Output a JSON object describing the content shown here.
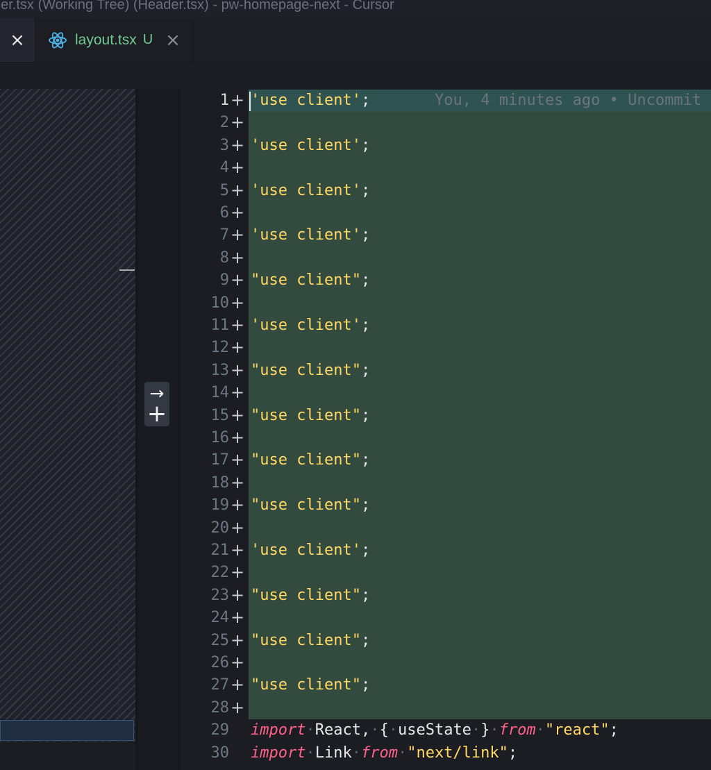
{
  "window": {
    "title": "der.tsx (Working Tree) (Header.tsx) - pw-homepage-next - Cursor"
  },
  "tabs": {
    "previous_close": "×",
    "active": {
      "name": "layout.tsx",
      "status": "U",
      "close": "×",
      "icon": "react-icon"
    }
  },
  "diff": {
    "revert_arrow": "→",
    "revert_plus": "+",
    "blame": "You, 4 minutes ago • Uncommit",
    "inserted_marker": "+"
  },
  "editor": {
    "lines": [
      {
        "n": "1",
        "text": "'use client';",
        "added": true
      },
      {
        "n": "2",
        "text": "",
        "added": true
      },
      {
        "n": "3",
        "text": "'use client';",
        "added": true
      },
      {
        "n": "4",
        "text": "",
        "added": true
      },
      {
        "n": "5",
        "text": "'use client';",
        "added": true
      },
      {
        "n": "6",
        "text": "",
        "added": true
      },
      {
        "n": "7",
        "text": "'use client';",
        "added": true
      },
      {
        "n": "8",
        "text": "",
        "added": true
      },
      {
        "n": "9",
        "text": "\"use client\";",
        "added": true
      },
      {
        "n": "10",
        "text": "",
        "added": true
      },
      {
        "n": "11",
        "text": "'use client';",
        "added": true
      },
      {
        "n": "12",
        "text": "",
        "added": true
      },
      {
        "n": "13",
        "text": "\"use client\";",
        "added": true
      },
      {
        "n": "14",
        "text": "",
        "added": true
      },
      {
        "n": "15",
        "text": "\"use client\";",
        "added": true
      },
      {
        "n": "16",
        "text": "",
        "added": true
      },
      {
        "n": "17",
        "text": "\"use client\";",
        "added": true
      },
      {
        "n": "18",
        "text": "",
        "added": true
      },
      {
        "n": "19",
        "text": "\"use client\";",
        "added": true
      },
      {
        "n": "20",
        "text": "",
        "added": true
      },
      {
        "n": "21",
        "text": "'use client';",
        "added": true
      },
      {
        "n": "22",
        "text": "",
        "added": true
      },
      {
        "n": "23",
        "text": "\"use client\";",
        "added": true
      },
      {
        "n": "24",
        "text": "",
        "added": true
      },
      {
        "n": "25",
        "text": "\"use client\";",
        "added": true
      },
      {
        "n": "26",
        "text": "",
        "added": true
      },
      {
        "n": "27",
        "text": "\"use client\";",
        "added": true
      },
      {
        "n": "28",
        "text": "",
        "added": true
      },
      {
        "n": "29",
        "text": "import React, { useState } from \"react\";",
        "added": false
      },
      {
        "n": "30",
        "text": "import Link from \"next/link\";",
        "added": false
      }
    ]
  },
  "colors": {
    "added_line_bg": "#334a3e",
    "current_line_bg": "#2f5350",
    "string": "#ffd866",
    "keyword": "#ff6188",
    "tab_untracked": "#73c991"
  }
}
